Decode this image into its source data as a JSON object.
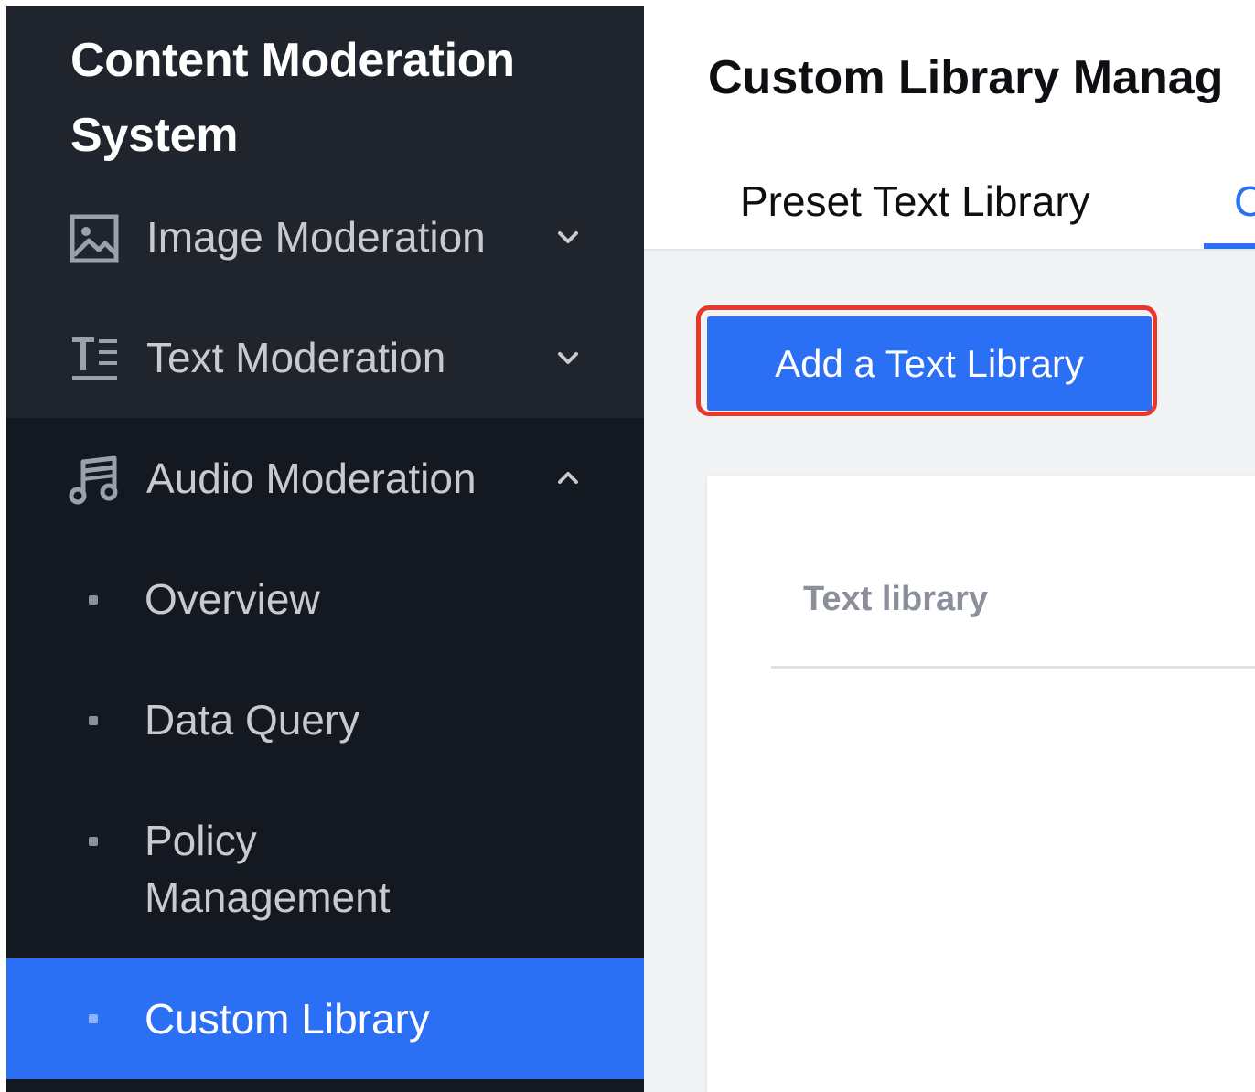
{
  "sidebar": {
    "app_title_line1": "Content Moderation",
    "app_title_line2": "System",
    "menu": [
      {
        "label": "Image Moderation",
        "icon": "image-icon",
        "expanded": false
      },
      {
        "label": "Text Moderation",
        "icon": "text-icon",
        "expanded": false
      },
      {
        "label": "Audio Moderation",
        "icon": "music-note-icon",
        "expanded": true
      }
    ],
    "submenu": [
      {
        "label": "Overview",
        "active": false
      },
      {
        "label": "Data Query",
        "active": false
      },
      {
        "label": "Policy",
        "label2": "Management",
        "active": false
      },
      {
        "label": "Custom Library",
        "active": true
      }
    ]
  },
  "main": {
    "page_title": "Custom Library Manag",
    "tabs": [
      {
        "label": "Preset Text Library",
        "active": false
      },
      {
        "label": "C",
        "active": true
      }
    ],
    "add_button_label": "Add a Text Library",
    "table": {
      "columns": [
        "Text library"
      ]
    }
  },
  "colors": {
    "sidebar_bg": "#141820",
    "sidebar_header_bg": "#20242d",
    "accent": "#2b6ff5",
    "highlight_border": "#e8382b",
    "content_bg": "#f2f3f5"
  }
}
